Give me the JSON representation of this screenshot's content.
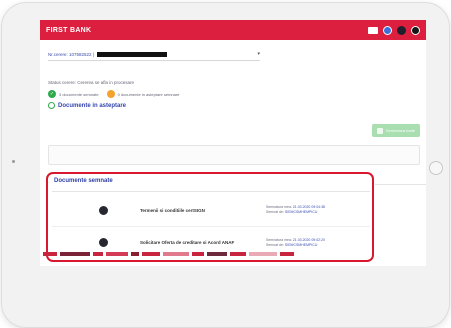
{
  "app": {
    "logo": "FIRST BANK"
  },
  "contract": {
    "label": "Nr.cerere: 107582522 |",
    "dropdown_caret": "▾"
  },
  "status": {
    "line": "Status cerere: Cererea se afla in procesare",
    "signed_count_text": "3 documente semnate",
    "pending_count_text": "0 documente in asteptare semnare"
  },
  "pending": {
    "link_label": "Documente in asteptare",
    "button_label": "Semneaza toate"
  },
  "signed": {
    "title": "Documente semnate",
    "documents": [
      {
        "title": "Termenii si conditiile certSIGN",
        "signed_label": "Semnatura mea:",
        "signed_date": "21.03.2020 09:04:38",
        "series_label": "Semnat de:",
        "series_value": "SIEMCSMHEMPICU"
      },
      {
        "title": "Solicitare Oferta de creditare si Acord ANAF",
        "signed_label": "Semnatura mea:",
        "signed_date": "21.03.2020 09:02:20",
        "series_label": "Semnat de:",
        "series_value": "SIEMCSMHEMPICU"
      }
    ]
  },
  "colors": {
    "brand_red": "#dc1f3e",
    "highlight_border": "#d8182f",
    "link_blue": "#3346b0",
    "success_green": "#2eaa4c",
    "warning_orange": "#f3a22d"
  },
  "footer_colors": [
    "#c9243d",
    "#7a2236",
    "#c9243d",
    "#d33a55",
    "#8a1d30",
    "#c9243d",
    "#e07a8c",
    "#c9243d",
    "#6c2a3b",
    "#c9243d",
    "#e9a9b5",
    "#c9243d"
  ]
}
